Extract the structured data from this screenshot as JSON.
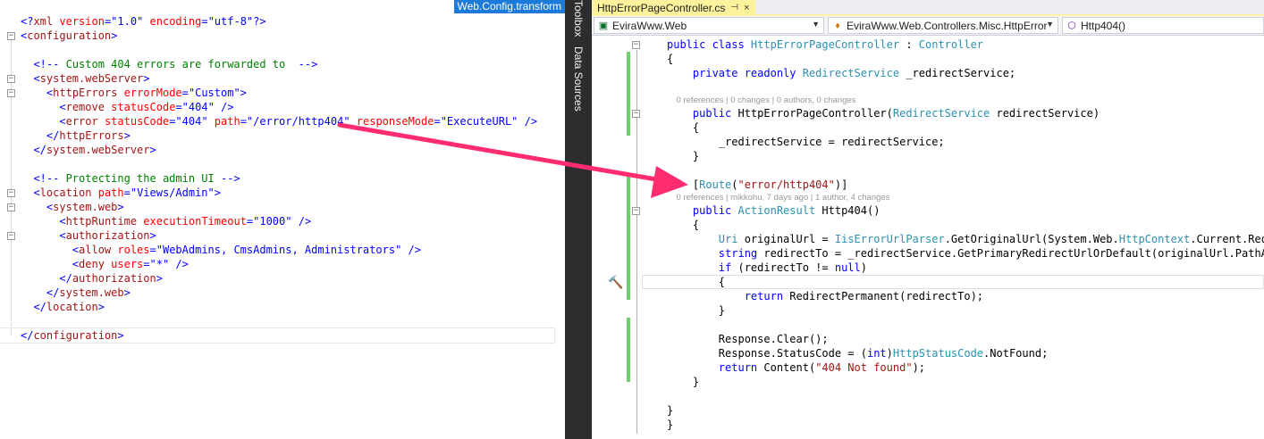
{
  "left": {
    "tab_title": "Web.Config.transform",
    "lines": [
      [
        {
          "c": "c-pun",
          "t": "<?"
        },
        {
          "c": "c-tag",
          "t": "xml"
        },
        {
          "c": "c-attr",
          "t": " version"
        },
        {
          "c": "c-pun",
          "t": "=\""
        },
        {
          "c": "c-val",
          "t": "1.0"
        },
        {
          "c": "c-pun",
          "t": "\""
        },
        {
          "c": "c-attr",
          "t": " encoding"
        },
        {
          "c": "c-pun",
          "t": "=\""
        },
        {
          "c": "c-val",
          "t": "utf-8"
        },
        {
          "c": "c-pun",
          "t": "\"?>"
        }
      ],
      [
        {
          "c": "c-pun",
          "t": "<"
        },
        {
          "c": "c-tag",
          "t": "configuration"
        },
        {
          "c": "c-pun",
          "t": ">"
        }
      ],
      [],
      [
        {
          "c": "c-txt",
          "t": "  "
        },
        {
          "c": "c-pun",
          "t": "<!--"
        },
        {
          "c": "c-com",
          "t": " Custom 404 errors are forwarded to  "
        },
        {
          "c": "c-pun",
          "t": "-->"
        }
      ],
      [
        {
          "c": "c-txt",
          "t": "  "
        },
        {
          "c": "c-pun",
          "t": "<"
        },
        {
          "c": "c-tag",
          "t": "system.webServer"
        },
        {
          "c": "c-pun",
          "t": ">"
        }
      ],
      [
        {
          "c": "c-txt",
          "t": "    "
        },
        {
          "c": "c-pun",
          "t": "<"
        },
        {
          "c": "c-tag",
          "t": "httpErrors"
        },
        {
          "c": "c-attr",
          "t": " errorMode"
        },
        {
          "c": "c-pun",
          "t": "=\""
        },
        {
          "c": "c-val",
          "t": "Custom"
        },
        {
          "c": "c-pun",
          "t": "\">"
        }
      ],
      [
        {
          "c": "c-txt",
          "t": "      "
        },
        {
          "c": "c-pun",
          "t": "<"
        },
        {
          "c": "c-tag",
          "t": "remove"
        },
        {
          "c": "c-attr",
          "t": " statusCode"
        },
        {
          "c": "c-pun",
          "t": "=\""
        },
        {
          "c": "c-val",
          "t": "404"
        },
        {
          "c": "c-pun",
          "t": "\" />"
        }
      ],
      [
        {
          "c": "c-txt",
          "t": "      "
        },
        {
          "c": "c-pun",
          "t": "<"
        },
        {
          "c": "c-tag",
          "t": "error"
        },
        {
          "c": "c-attr",
          "t": " statusCode"
        },
        {
          "c": "c-pun",
          "t": "=\""
        },
        {
          "c": "c-val",
          "t": "404"
        },
        {
          "c": "c-pun",
          "t": "\""
        },
        {
          "c": "c-attr",
          "t": " path"
        },
        {
          "c": "c-pun",
          "t": "=\""
        },
        {
          "c": "c-val",
          "t": "/error/http404"
        },
        {
          "c": "c-pun",
          "t": "\""
        },
        {
          "c": "c-attr",
          "t": " responseMode"
        },
        {
          "c": "c-pun",
          "t": "=\""
        },
        {
          "c": "c-val",
          "t": "ExecuteURL"
        },
        {
          "c": "c-pun",
          "t": "\" />"
        }
      ],
      [
        {
          "c": "c-txt",
          "t": "    "
        },
        {
          "c": "c-pun",
          "t": "</"
        },
        {
          "c": "c-tag",
          "t": "httpErrors"
        },
        {
          "c": "c-pun",
          "t": ">"
        }
      ],
      [
        {
          "c": "c-txt",
          "t": "  "
        },
        {
          "c": "c-pun",
          "t": "</"
        },
        {
          "c": "c-tag",
          "t": "system.webServer"
        },
        {
          "c": "c-pun",
          "t": ">"
        }
      ],
      [],
      [
        {
          "c": "c-txt",
          "t": "  "
        },
        {
          "c": "c-pun",
          "t": "<!--"
        },
        {
          "c": "c-com",
          "t": " Protecting the admin UI "
        },
        {
          "c": "c-pun",
          "t": "-->"
        }
      ],
      [
        {
          "c": "c-txt",
          "t": "  "
        },
        {
          "c": "c-pun",
          "t": "<"
        },
        {
          "c": "c-tag",
          "t": "location"
        },
        {
          "c": "c-attr",
          "t": " path"
        },
        {
          "c": "c-pun",
          "t": "=\""
        },
        {
          "c": "c-val",
          "t": "Views/Admin"
        },
        {
          "c": "c-pun",
          "t": "\">"
        }
      ],
      [
        {
          "c": "c-txt",
          "t": "    "
        },
        {
          "c": "c-pun",
          "t": "<"
        },
        {
          "c": "c-tag",
          "t": "system.web"
        },
        {
          "c": "c-pun",
          "t": ">"
        }
      ],
      [
        {
          "c": "c-txt",
          "t": "      "
        },
        {
          "c": "c-pun",
          "t": "<"
        },
        {
          "c": "c-tag",
          "t": "httpRuntime"
        },
        {
          "c": "c-attr",
          "t": " executionTimeout"
        },
        {
          "c": "c-pun",
          "t": "=\""
        },
        {
          "c": "c-val",
          "t": "1000"
        },
        {
          "c": "c-pun",
          "t": "\" />"
        }
      ],
      [
        {
          "c": "c-txt",
          "t": "      "
        },
        {
          "c": "c-pun",
          "t": "<"
        },
        {
          "c": "c-tag",
          "t": "authorization"
        },
        {
          "c": "c-pun",
          "t": ">"
        }
      ],
      [
        {
          "c": "c-txt",
          "t": "        "
        },
        {
          "c": "c-pun",
          "t": "<"
        },
        {
          "c": "c-tag",
          "t": "allow"
        },
        {
          "c": "c-attr",
          "t": " roles"
        },
        {
          "c": "c-pun",
          "t": "=\""
        },
        {
          "c": "c-val",
          "t": "WebAdmins, CmsAdmins, Administrators"
        },
        {
          "c": "c-pun",
          "t": "\" />"
        }
      ],
      [
        {
          "c": "c-txt",
          "t": "        "
        },
        {
          "c": "c-pun",
          "t": "<"
        },
        {
          "c": "c-tag",
          "t": "deny"
        },
        {
          "c": "c-attr",
          "t": " users"
        },
        {
          "c": "c-pun",
          "t": "=\""
        },
        {
          "c": "c-val",
          "t": "*"
        },
        {
          "c": "c-pun",
          "t": "\" />"
        }
      ],
      [
        {
          "c": "c-txt",
          "t": "      "
        },
        {
          "c": "c-pun",
          "t": "</"
        },
        {
          "c": "c-tag",
          "t": "authorization"
        },
        {
          "c": "c-pun",
          "t": ">"
        }
      ],
      [
        {
          "c": "c-txt",
          "t": "    "
        },
        {
          "c": "c-pun",
          "t": "</"
        },
        {
          "c": "c-tag",
          "t": "system.web"
        },
        {
          "c": "c-pun",
          "t": ">"
        }
      ],
      [
        {
          "c": "c-txt",
          "t": "  "
        },
        {
          "c": "c-pun",
          "t": "</"
        },
        {
          "c": "c-tag",
          "t": "location"
        },
        {
          "c": "c-pun",
          "t": ">"
        }
      ],
      [],
      [
        {
          "c": "c-pun",
          "t": "</"
        },
        {
          "c": "c-tag",
          "t": "configuration"
        },
        {
          "c": "c-pun",
          "t": ">"
        }
      ]
    ]
  },
  "toolstrip": {
    "items": [
      "Toolbox",
      "Data Sources"
    ]
  },
  "right": {
    "tab_title": "HttpErrorPageController.cs",
    "tab_pin": "⊣",
    "tab_close": "×",
    "nav": {
      "project": "EviraWww.Web",
      "type": "EviraWww.Web.Controllers.Misc.HttpError",
      "member": "Http404()"
    },
    "lines": [
      [
        {
          "c": "k",
          "t": "public class "
        },
        {
          "c": "t",
          "t": "HttpErrorPageController"
        },
        {
          "c": "p",
          "t": " : "
        },
        {
          "c": "t",
          "t": "Controller"
        }
      ],
      [
        {
          "c": "p",
          "t": "{"
        }
      ],
      [
        {
          "c": "p",
          "t": "    "
        },
        {
          "c": "k",
          "t": "private readonly "
        },
        {
          "c": "t",
          "t": "RedirectService"
        },
        {
          "c": "p",
          "t": " _redirectService;"
        }
      ],
      [],
      [
        {
          "c": "lens",
          "t": "    0 references | 0 changes | 0 authors, 0 changes"
        }
      ],
      [
        {
          "c": "p",
          "t": "    "
        },
        {
          "c": "k",
          "t": "public "
        },
        {
          "c": "p",
          "t": "HttpErrorPageController("
        },
        {
          "c": "t",
          "t": "RedirectService"
        },
        {
          "c": "p",
          "t": " redirectService)"
        }
      ],
      [
        {
          "c": "p",
          "t": "    {"
        }
      ],
      [
        {
          "c": "p",
          "t": "        _redirectService = redirectService;"
        }
      ],
      [
        {
          "c": "p",
          "t": "    }"
        }
      ],
      [],
      [
        {
          "c": "p",
          "t": "    ["
        },
        {
          "c": "t",
          "t": "Route"
        },
        {
          "c": "p",
          "t": "("
        },
        {
          "c": "s",
          "t": "\"error/http404\""
        },
        {
          "c": "p",
          "t": ")]"
        }
      ],
      [
        {
          "c": "lens",
          "t": "    0 references | mikkohu, 7 days ago | 1 author, 4 changes"
        }
      ],
      [
        {
          "c": "p",
          "t": "    "
        },
        {
          "c": "k",
          "t": "public "
        },
        {
          "c": "t",
          "t": "ActionResult"
        },
        {
          "c": "p",
          "t": " Http404()"
        }
      ],
      [
        {
          "c": "p",
          "t": "    {"
        }
      ],
      [
        {
          "c": "p",
          "t": "        "
        },
        {
          "c": "t",
          "t": "Uri"
        },
        {
          "c": "p",
          "t": " originalUrl = "
        },
        {
          "c": "t",
          "t": "IisErrorUrlParser"
        },
        {
          "c": "p",
          "t": ".GetOriginalUrl(System.Web."
        },
        {
          "c": "t",
          "t": "HttpContext"
        },
        {
          "c": "p",
          "t": ".Current.Reques"
        }
      ],
      [
        {
          "c": "p",
          "t": "        "
        },
        {
          "c": "k",
          "t": "string"
        },
        {
          "c": "p",
          "t": " redirectTo = _redirectService.GetPrimaryRedirectUrlOrDefault(originalUrl.PathAndQ"
        }
      ],
      [
        {
          "c": "p",
          "t": "        "
        },
        {
          "c": "k",
          "t": "if"
        },
        {
          "c": "p",
          "t": " (redirectTo != "
        },
        {
          "c": "k",
          "t": "null"
        },
        {
          "c": "p",
          "t": ")"
        }
      ],
      [
        {
          "c": "p",
          "t": "        {"
        }
      ],
      [
        {
          "c": "p",
          "t": "            "
        },
        {
          "c": "k",
          "t": "return"
        },
        {
          "c": "p",
          "t": " RedirectPermanent(redirectTo);"
        }
      ],
      [
        {
          "c": "p",
          "t": "        }"
        }
      ],
      [],
      [
        {
          "c": "p",
          "t": "        Response.Clear();"
        }
      ],
      [
        {
          "c": "p",
          "t": "        Response.StatusCode = ("
        },
        {
          "c": "k",
          "t": "int"
        },
        {
          "c": "p",
          "t": ")"
        },
        {
          "c": "t",
          "t": "HttpStatusCode"
        },
        {
          "c": "p",
          "t": ".NotFound;"
        }
      ],
      [
        {
          "c": "p",
          "t": "        "
        },
        {
          "c": "k",
          "t": "return"
        },
        {
          "c": "p",
          "t": " Content("
        },
        {
          "c": "s",
          "t": "\"404 Not found\""
        },
        {
          "c": "p",
          "t": ");"
        }
      ],
      [
        {
          "c": "p",
          "t": "    }"
        }
      ],
      [],
      [
        {
          "c": "p",
          "t": "}"
        }
      ],
      [
        {
          "c": "p",
          "t": "}"
        }
      ]
    ]
  },
  "colors": {
    "arrow": "#ff2d6f",
    "tab_active": "#fff29d",
    "left_tab": "#1c7ad8",
    "toolstrip": "#2d2d30",
    "change_bar": "#6cd16c"
  }
}
